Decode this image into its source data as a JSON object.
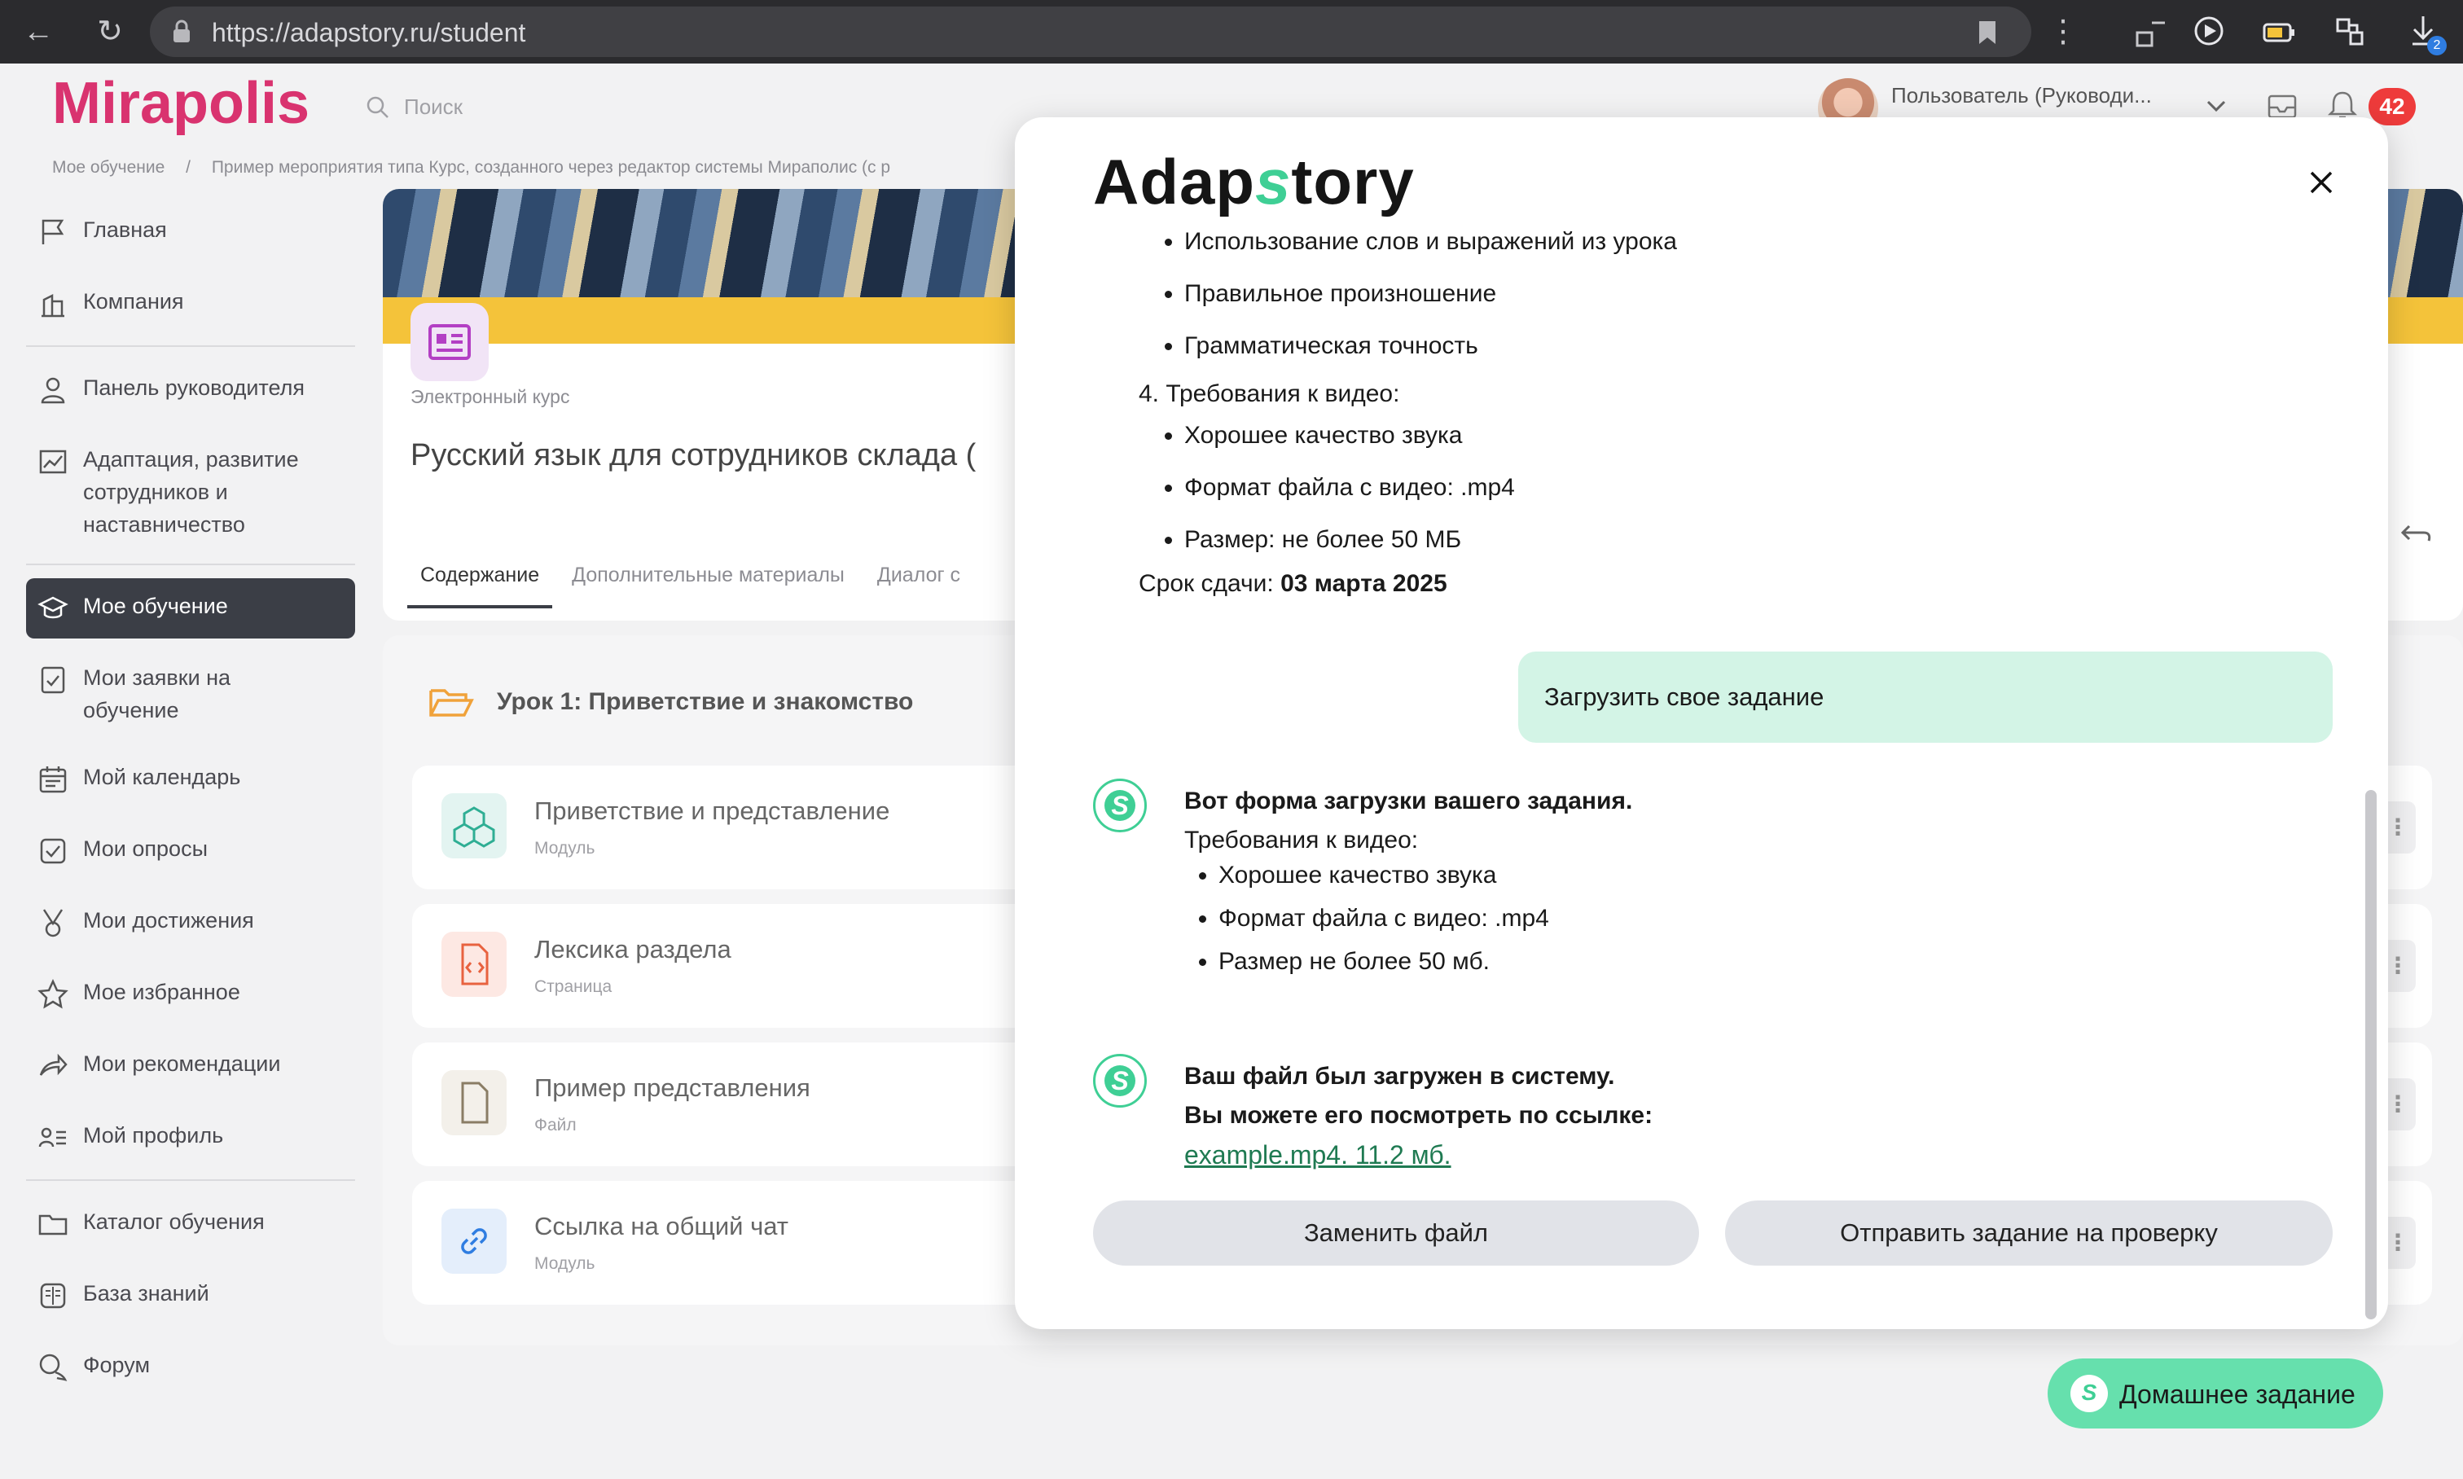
{
  "browser": {
    "url": "https://adapstory.ru/student",
    "download_count": "2"
  },
  "header": {
    "logo": "Mirapolis",
    "search_placeholder": "Поиск",
    "user_name": "Пользователь (Руководи...",
    "notifications_count": "42"
  },
  "breadcrumb": [
    "Мое обучение",
    "/",
    "Пример мероприятия типа Курс, созданного через редактор системы Мираполис (с р"
  ],
  "sidebar": {
    "items": [
      {
        "label": "Главная",
        "icon": "flag-icon"
      },
      {
        "label": "Компания",
        "icon": "building-icon"
      },
      {
        "label": "Панель руководителя",
        "icon": "manager-icon"
      },
      {
        "label": "Адаптация, развитие сотрудников и наставничество",
        "icon": "chart-icon"
      },
      {
        "label": "Мое обучение",
        "icon": "graduation-cap-icon",
        "active": true
      },
      {
        "label": "Мои заявки на обучение",
        "icon": "checklist-icon"
      },
      {
        "label": "Мой календарь",
        "icon": "calendar-icon"
      },
      {
        "label": "Мои опросы",
        "icon": "survey-icon"
      },
      {
        "label": "Мои достижения",
        "icon": "medal-icon"
      },
      {
        "label": "Мое избранное",
        "icon": "star-icon"
      },
      {
        "label": "Мои рекомендации",
        "icon": "share-arrow-icon"
      },
      {
        "label": "Мой профиль",
        "icon": "profile-list-icon"
      },
      {
        "label": "Каталог обучения",
        "icon": "folder-icon"
      },
      {
        "label": "База знаний",
        "icon": "book-icon"
      },
      {
        "label": "Форум",
        "icon": "chat-bubbles-icon"
      }
    ]
  },
  "course": {
    "type": "Электронный курс",
    "title": "Русский язык для сотрудников склада (",
    "tabs": [
      "Содержание",
      "Дополнительные материалы",
      "Диалог с"
    ]
  },
  "lesson": {
    "title": "Урок 1: Приветствие и знакомство",
    "items": [
      {
        "title": "Приветствие и представление",
        "subtitle": "Модуль",
        "icon_color": "#e3f4f1"
      },
      {
        "title": "Лексика раздела",
        "subtitle": "Страница",
        "icon_color": "#fde8e3"
      },
      {
        "title": "Пример представления",
        "subtitle": "Файл",
        "icon_color": "#f3f0ea"
      },
      {
        "title": "Ссылка на общий чат",
        "subtitle": "Модуль",
        "icon_color": "#e4eefb"
      }
    ]
  },
  "modal": {
    "logo_left": "Adap",
    "logo_s": "s",
    "logo_right": "tory",
    "top_bullets": [
      "Использование слов и выражений из урока",
      "Правильное произношение",
      "Грамматическая точность"
    ],
    "section4_title": "4. Требования к видео:",
    "section4_bullets": [
      "Хорошее качество звука",
      "Формат файла с видео: .mp4",
      "Размер: не более 50 МБ"
    ],
    "deadline_label": "Срок сдачи:",
    "deadline_value": "03 марта 2025",
    "user_message": "Загрузить свое задание",
    "bot1_title": "Вот форма загрузки вашего задания.",
    "bot1_subtitle": "Требования к видео:",
    "bot1_bullets": [
      "Хорошее качество звука",
      "Формат файла с видео: .mp4",
      "Размер не более 50 мб."
    ],
    "bot2_line1": "Ваш файл был загружен в систему.",
    "bot2_line2": "Вы можете его посмотреть по ссылке:",
    "bot2_link": "example.mp4. 11.2 мб.",
    "btn_replace": "Заменить файл",
    "btn_submit": "Отправить задание на проверку"
  },
  "homework_button": "Домашнее задание",
  "colors": {
    "brand": "#d9336f",
    "accent_green": "#3fcf95",
    "badge_red": "#ee3b3b",
    "sidebar_active": "#3b3e46"
  }
}
